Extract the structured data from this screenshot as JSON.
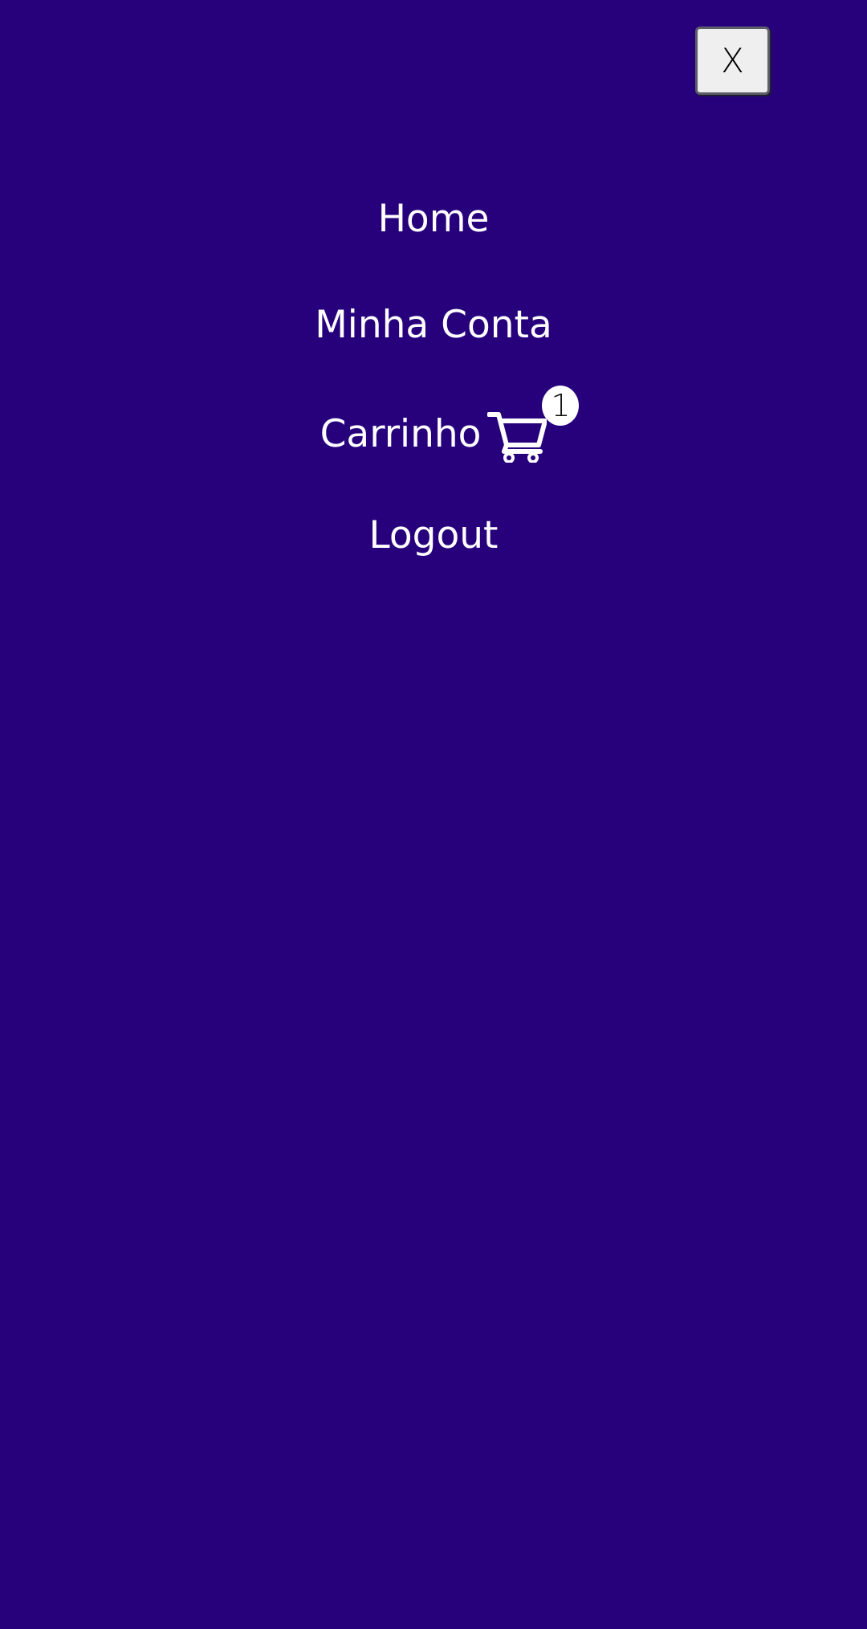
{
  "close_button": {
    "label": "X"
  },
  "menu": {
    "items": [
      {
        "label": "Home"
      },
      {
        "label": "Minha Conta"
      },
      {
        "label": "Carrinho",
        "icon": "cart-icon",
        "badge": "1"
      },
      {
        "label": "Logout"
      }
    ]
  },
  "colors": {
    "background": "#27007c",
    "text": "#ffffff",
    "close_button_bg": "#efefef"
  }
}
